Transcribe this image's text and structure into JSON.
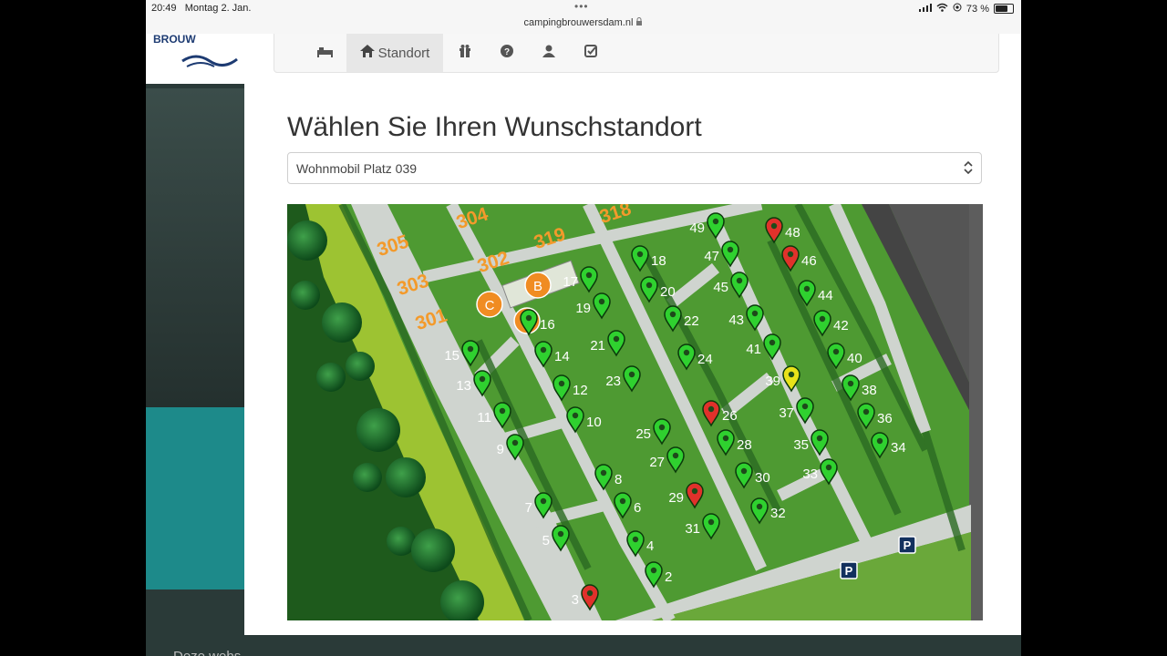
{
  "statusbar": {
    "time": "20:49",
    "date": "Montag 2. Jan.",
    "url": "campingbrouwersdam.nl",
    "battery": "73 %",
    "battery_level": 0.73
  },
  "background": {
    "footer_text": "Deze webs"
  },
  "tabs": [
    {
      "icon": "bed-icon",
      "label": ""
    },
    {
      "icon": "home-icon",
      "label": "Standort",
      "active": true
    },
    {
      "icon": "gift-icon",
      "label": ""
    },
    {
      "icon": "question-icon",
      "label": ""
    },
    {
      "icon": "user-icon",
      "label": ""
    },
    {
      "icon": "check-square-icon",
      "label": ""
    }
  ],
  "heading": "Wählen Sie Ihren Wunschstandort",
  "select": {
    "value": "Wohnmobil Platz 039"
  },
  "map": {
    "zone_labels": [
      "305",
      "304",
      "302",
      "319",
      "318",
      "303",
      "301"
    ],
    "building_labels": [
      "B",
      "C",
      "D"
    ],
    "spots": [
      {
        "n": "2",
        "status": "available"
      },
      {
        "n": "3",
        "status": "occupied"
      },
      {
        "n": "4",
        "status": "available"
      },
      {
        "n": "5",
        "status": "available"
      },
      {
        "n": "6",
        "status": "available"
      },
      {
        "n": "7",
        "status": "available"
      },
      {
        "n": "8",
        "status": "available"
      },
      {
        "n": "9",
        "status": "available"
      },
      {
        "n": "10",
        "status": "available"
      },
      {
        "n": "11",
        "status": "available"
      },
      {
        "n": "12",
        "status": "available"
      },
      {
        "n": "13",
        "status": "available"
      },
      {
        "n": "14",
        "status": "available"
      },
      {
        "n": "15",
        "status": "available"
      },
      {
        "n": "16",
        "status": "available"
      },
      {
        "n": "17",
        "status": "available"
      },
      {
        "n": "18",
        "status": "available"
      },
      {
        "n": "19",
        "status": "available"
      },
      {
        "n": "20",
        "status": "available"
      },
      {
        "n": "21",
        "status": "available"
      },
      {
        "n": "22",
        "status": "available"
      },
      {
        "n": "23",
        "status": "available"
      },
      {
        "n": "24",
        "status": "available"
      },
      {
        "n": "25",
        "status": "available"
      },
      {
        "n": "26",
        "status": "occupied"
      },
      {
        "n": "27",
        "status": "available"
      },
      {
        "n": "28",
        "status": "available"
      },
      {
        "n": "29",
        "status": "occupied"
      },
      {
        "n": "30",
        "status": "available"
      },
      {
        "n": "31",
        "status": "available"
      },
      {
        "n": "32",
        "status": "available"
      },
      {
        "n": "33",
        "status": "available"
      },
      {
        "n": "34",
        "status": "available"
      },
      {
        "n": "35",
        "status": "available"
      },
      {
        "n": "36",
        "status": "available"
      },
      {
        "n": "37",
        "status": "available"
      },
      {
        "n": "38",
        "status": "available"
      },
      {
        "n": "39",
        "status": "selected"
      },
      {
        "n": "40",
        "status": "available"
      },
      {
        "n": "41",
        "status": "available"
      },
      {
        "n": "42",
        "status": "available"
      },
      {
        "n": "43",
        "status": "available"
      },
      {
        "n": "44",
        "status": "available"
      },
      {
        "n": "45",
        "status": "available"
      },
      {
        "n": "46",
        "status": "occupied"
      },
      {
        "n": "47",
        "status": "available"
      },
      {
        "n": "48",
        "status": "occupied"
      },
      {
        "n": "49",
        "status": "available"
      }
    ],
    "parking_label": "P",
    "colors": {
      "available": "#2fd12f",
      "occupied": "#e0312b",
      "selected": "#e8e21a",
      "zone_label": "#f39a2b",
      "building_marker": "#f08c22"
    }
  }
}
